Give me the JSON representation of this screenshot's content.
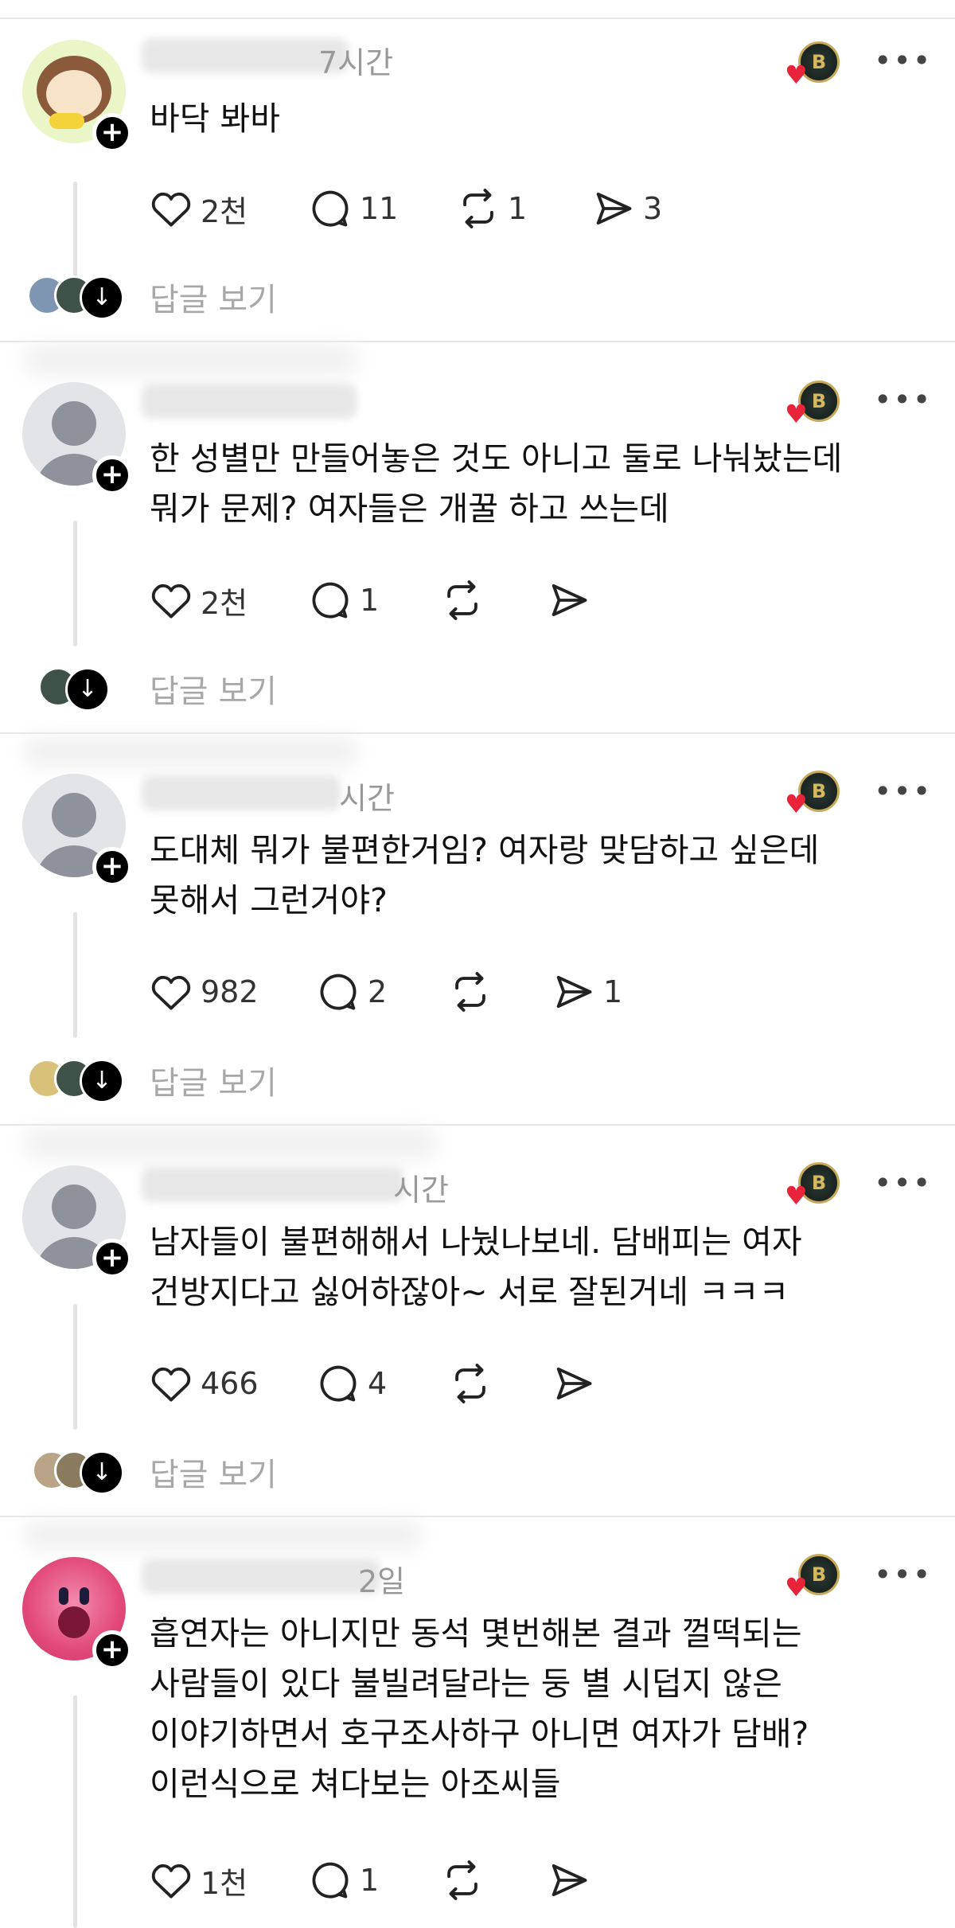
{
  "icons": {
    "like": "heart-icon",
    "comment": "speech-bubble-icon",
    "repost": "repost-icon",
    "share": "paper-plane-icon",
    "more": "more-options-icon",
    "expand": "arrow-down-icon",
    "follow": "plus-icon",
    "badge": "bitcoin-badge-icon"
  },
  "colors": {
    "heart_badge": "#e8233a",
    "muted_text": "#999999",
    "reply_text": "#a8a8a8"
  },
  "more_label": "•••",
  "follow_label": "+",
  "expand_label": "↓",
  "badge_label": "B",
  "badge_heart": "♥",
  "posts": [
    {
      "time": "7시간",
      "lines": [
        "바닥 봐바"
      ],
      "likes": "2천",
      "comments": "11",
      "reposts": "1",
      "shares": "3",
      "reply_label": "답글 보기"
    },
    {
      "time": "",
      "lines": [
        "한 성별만 만들어놓은 것도 아니고 둘로 나눠놨는데",
        "뭐가 문제? 여자들은 개꿀 하고 쓰는데"
      ],
      "likes": "2천",
      "comments": "1",
      "reposts": "",
      "shares": "",
      "reply_label": "답글 보기"
    },
    {
      "time": "시간",
      "lines": [
        "도대체 뭐가 불편한거임? 여자랑 맞담하고 싶은데",
        "못해서 그런거야?"
      ],
      "likes": "982",
      "comments": "2",
      "reposts": "",
      "shares": "1",
      "reply_label": "답글 보기"
    },
    {
      "time": "시간",
      "lines": [
        "남자들이 불편해해서 나눴나보네. 담배피는 여자",
        "건방지다고 싫어하잖아~ 서로 잘된거네 ㅋㅋㅋ"
      ],
      "likes": "466",
      "comments": "4",
      "reposts": "",
      "shares": "",
      "reply_label": "답글 보기"
    },
    {
      "time": "2일",
      "lines": [
        "흡연자는 아니지만 동석 몇번해본 결과 껄떡되는",
        "사람들이 있다 불빌려달라는 둥 별 시덥지 않은",
        "이야기하면서 호구조사하구 아니면 여자가 담배?",
        "이런식으로 쳐다보는 아조씨들"
      ],
      "likes": "1천",
      "comments": "1",
      "reposts": "",
      "shares": "",
      "reply_label": ""
    }
  ]
}
